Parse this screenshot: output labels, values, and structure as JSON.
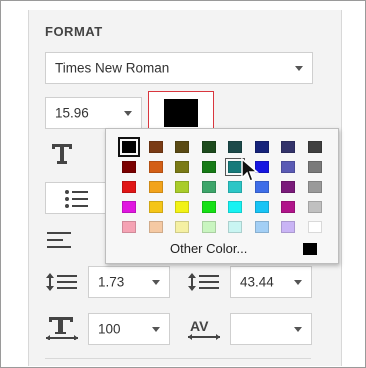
{
  "section": {
    "title": "FORMAT"
  },
  "font": {
    "family": "Times New Roman",
    "size": "15.96"
  },
  "text_color": {
    "value": "#000000"
  },
  "line_spacing": {
    "value": "1.73"
  },
  "paragraph_spacing": {
    "value": "43.44"
  },
  "char_scale": {
    "value": "100"
  },
  "char_spacing": {
    "value": ""
  },
  "palette": {
    "other_label": "Other Color...",
    "other_color": "#000000",
    "rows": [
      [
        "#000000",
        "#7a3b15",
        "#5a4a14",
        "#1d4a1d",
        "#1d4a4a",
        "#16237a",
        "#33336a",
        "#404040"
      ],
      [
        "#7a0000",
        "#d35f16",
        "#7a7a16",
        "#167a16",
        "#167a7a",
        "#1616e0",
        "#5a5ab4",
        "#7a7a7a"
      ],
      [
        "#e01616",
        "#f2a31b",
        "#a9cc2a",
        "#3da56a",
        "#2cc6c6",
        "#3f6ee8",
        "#7a1b7a",
        "#9a9a9a"
      ],
      [
        "#e016e0",
        "#f5c518",
        "#f2f216",
        "#16e016",
        "#18f2f2",
        "#18c4f5",
        "#b0148a",
        "#c0c0c0"
      ],
      [
        "#f5a3b4",
        "#f5c9a3",
        "#f5f0a3",
        "#c9f5c0",
        "#c9f5f2",
        "#a3cff5",
        "#c9b4f5",
        "#ffffff"
      ]
    ]
  }
}
